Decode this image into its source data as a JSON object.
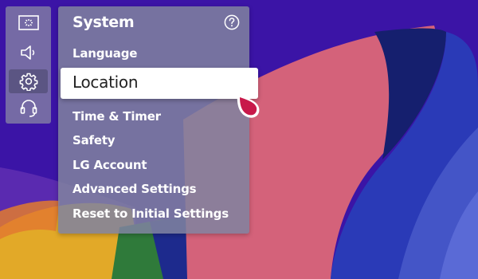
{
  "screen": {
    "title": "System",
    "help_icon": "question-circle-icon"
  },
  "rail": {
    "items": [
      {
        "icon": "picture-icon",
        "active": false
      },
      {
        "icon": "sound-icon",
        "active": false
      },
      {
        "icon": "gear-icon",
        "active": true
      },
      {
        "icon": "support-headset-icon",
        "active": false
      }
    ]
  },
  "menu": {
    "focused_label": "Location",
    "items": [
      {
        "label": "Language"
      },
      {
        "label": "Location"
      },
      {
        "label": "Time & Timer"
      },
      {
        "label": "Safety"
      },
      {
        "label": "LG Account"
      },
      {
        "label": "Advanced Settings"
      },
      {
        "label": "Reset to Initial Settings"
      }
    ]
  },
  "colors": {
    "background": "#3d16a8",
    "accent_pointer": "#c8194a",
    "panel": "#80829f"
  }
}
